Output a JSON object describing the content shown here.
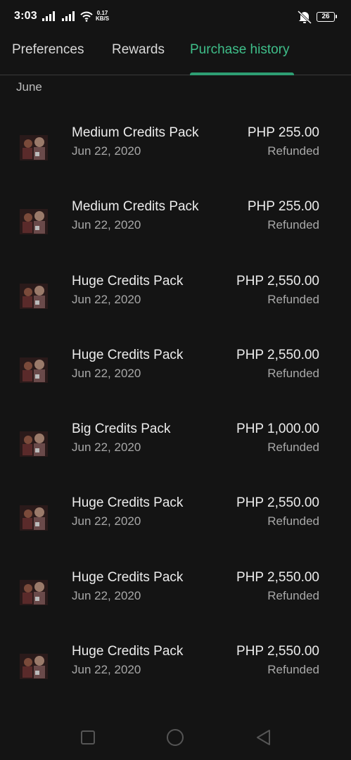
{
  "status_bar": {
    "time": "3:03",
    "net_speed_value": "0.17",
    "net_speed_unit": "KB/S",
    "battery": "26",
    "icons": [
      "signal-icon",
      "signal-icon",
      "wifi-icon",
      "mute-icon",
      "battery-icon"
    ]
  },
  "tabs": [
    {
      "label": "Preferences",
      "active": false
    },
    {
      "label": "Rewards",
      "active": false
    },
    {
      "label": "Purchase history",
      "active": true
    }
  ],
  "section_header": "June",
  "purchases": [
    {
      "title": "Medium Credits Pack",
      "date": "Jun 22, 2020",
      "price": "PHP 255.00",
      "status": "Refunded"
    },
    {
      "title": "Medium Credits Pack",
      "date": "Jun 22, 2020",
      "price": "PHP 255.00",
      "status": "Refunded"
    },
    {
      "title": "Huge Credits Pack",
      "date": "Jun 22, 2020",
      "price": "PHP 2,550.00",
      "status": "Refunded"
    },
    {
      "title": "Huge Credits Pack",
      "date": "Jun 22, 2020",
      "price": "PHP 2,550.00",
      "status": "Refunded"
    },
    {
      "title": "Big Credits Pack",
      "date": "Jun 22, 2020",
      "price": "PHP 1,000.00",
      "status": "Refunded"
    },
    {
      "title": "Huge Credits Pack",
      "date": "Jun 22, 2020",
      "price": "PHP 2,550.00",
      "status": "Refunded"
    },
    {
      "title": "Huge Credits Pack",
      "date": "Jun 22, 2020",
      "price": "PHP 2,550.00",
      "status": "Refunded"
    },
    {
      "title": "Huge Credits Pack",
      "date": "Jun 22, 2020",
      "price": "PHP 2,550.00",
      "status": "Refunded"
    }
  ],
  "nav_bar": {
    "icons": [
      "recents-icon",
      "home-icon",
      "back-icon"
    ]
  },
  "colors": {
    "background": "#141414",
    "accent": "#3fbf8a",
    "indicator": "#2e9e73",
    "primary_text": "#ececec",
    "secondary_text": "#a8a8a8"
  }
}
